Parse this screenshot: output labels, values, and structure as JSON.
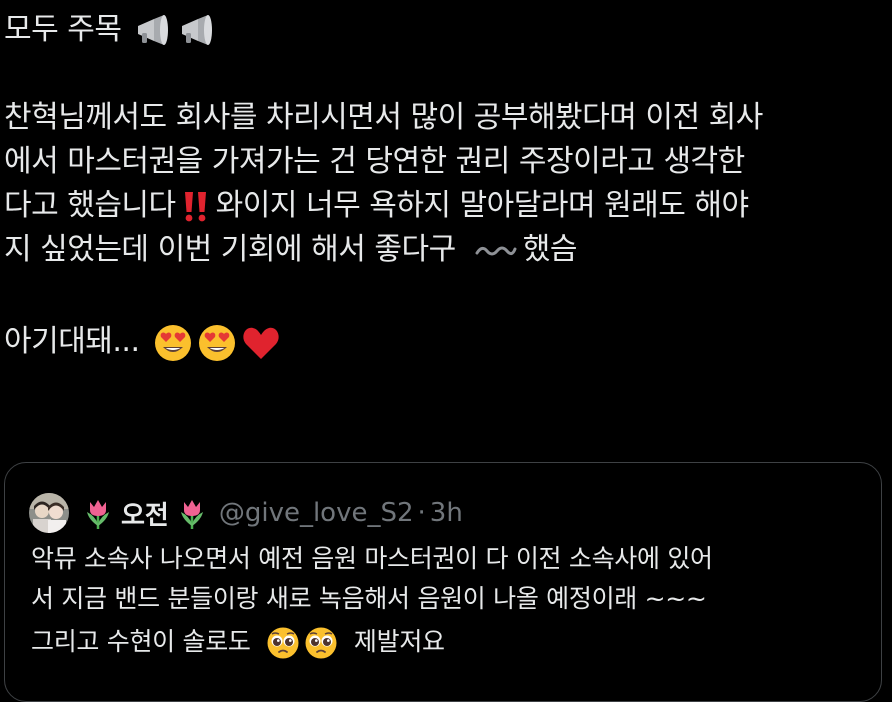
{
  "post": {
    "lines": [
      "모두 주목",
      "찬혁님께서도 회사를 차리시면서 많이 공부해봤다며 이전 회사",
      "에서 마스터권을 가져가는 건 당연한 권리 주장이라고 생각한",
      "다고 했습니다",
      "와이지 너무 욕하지 말아달라며 원래도 해야",
      "지 싶었는데 이번 기회에 해서 좋다구",
      "했슴",
      "아기대돼..."
    ]
  },
  "quote": {
    "display_name": "오전",
    "handle": "@give_love_S2",
    "separator": "·",
    "time": "3h",
    "lines": [
      "악뮤 소속사 나오면서 예전 음원 마스터권이 다 이전 소속사에 있어",
      "서 지금 밴드 분들이랑 새로 녹음해서 음원이 나올 예정이래 ~~~",
      "그리고 수현이 솔로도",
      "제발저요"
    ]
  },
  "icons": {
    "megaphone": "megaphone-emoji",
    "exclamation": "double-exclamation-emoji",
    "wavy": "wavy-dash-emoji",
    "heart_eyes": "heart-eyes-emoji",
    "heart": "red-heart-emoji",
    "tulip": "tulip-emoji",
    "pleading": "pleading-face-emoji"
  },
  "colors": {
    "background": "#000000",
    "text": "#e7e9ea",
    "muted": "#71767b",
    "border": "#3e4144",
    "red": "#e0232e"
  }
}
